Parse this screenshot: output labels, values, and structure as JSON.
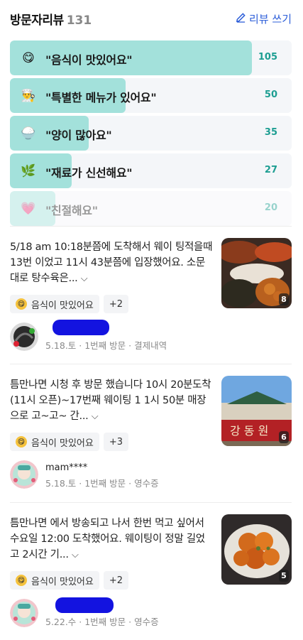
{
  "header": {
    "title": "방문자리뷰",
    "count": "131",
    "write_label": "리뷰 쓰기"
  },
  "keyword_stats": [
    {
      "icon": "taste-emoji-icon",
      "glyph": "😋",
      "label": "\"음식이 맛있어요\"",
      "count": "105",
      "fraction": 0.86
    },
    {
      "icon": "chef-icon",
      "glyph": "👨‍🍳",
      "label": "\"특별한 메뉴가 있어요\"",
      "count": "50",
      "fraction": 0.41
    },
    {
      "icon": "rice-bowl-icon",
      "glyph": "🍚",
      "label": "\"양이 많아요\"",
      "count": "35",
      "fraction": 0.28
    },
    {
      "icon": "leaf-icon",
      "glyph": "🌿",
      "label": "\"재료가 신선해요\"",
      "count": "27",
      "fraction": 0.22
    },
    {
      "icon": "heart-icon",
      "glyph": "💗",
      "label": "\"친절해요\"",
      "count": "20",
      "fraction": 0.16
    }
  ],
  "reviews": [
    {
      "text": "5/18 am 10:18분쯤에 도착해서 웨이 팅적을때 13번 이었고 11시 43분쯤에 입장했어요. 소문대로 탕수육은...",
      "photo_count": "8",
      "tag": "음식이 맛있어요",
      "more": "+2",
      "name": "",
      "date": "5.18.토",
      "visit": "1번째 방문",
      "proof": "결제내역"
    },
    {
      "text": "틈만나면 시청 후 방문 했습니다 10시 20분도착(11시 오픈)~17번째 웨이팅 1 1시 50분 매장으로 고~고~ 간...",
      "photo_count": "6",
      "tag": "음식이 맛있어요",
      "more": "+3",
      "name": "mam****",
      "date": "5.18.토",
      "visit": "1번째 방문",
      "proof": "영수증"
    },
    {
      "text": "틈만나면 에서 방송되고 나서 한번 먹고 싶어서 수요일 12:00 도착했어요. 웨이팅이 정말 길었고 2시간 기...",
      "photo_count": "5",
      "tag": "음식이 맛있어요",
      "more": "+2",
      "name": "",
      "date": "5.22.수",
      "visit": "1번째 방문",
      "proof": "영수증"
    }
  ],
  "colors": {
    "accent": "#1d9e92",
    "bar": "#a3e1db",
    "link": "#2e5fd9"
  }
}
